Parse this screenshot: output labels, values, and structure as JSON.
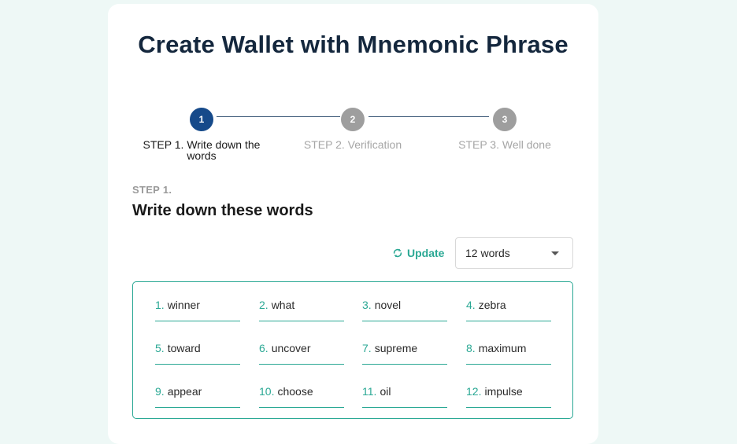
{
  "page": {
    "title": "Create Wallet with Mnemonic Phrase"
  },
  "stepper": {
    "steps": [
      {
        "number": "1",
        "label": "STEP 1. Write down the words",
        "state": "active"
      },
      {
        "number": "2",
        "label": "STEP 2. Verification",
        "state": "inactive"
      },
      {
        "number": "3",
        "label": "STEP 3. Well done",
        "state": "inactive"
      }
    ]
  },
  "section": {
    "kicker": "STEP 1.",
    "title": "Write down these words"
  },
  "controls": {
    "update_label": "Update",
    "update_icon": "refresh-icon",
    "word_count_selected": "12 words",
    "dropdown_icon": "caret-down-icon"
  },
  "mnemonic": {
    "words": [
      {
        "num": "1.",
        "word": "winner"
      },
      {
        "num": "2.",
        "word": "what"
      },
      {
        "num": "3.",
        "word": "novel"
      },
      {
        "num": "4.",
        "word": "zebra"
      },
      {
        "num": "5.",
        "word": "toward"
      },
      {
        "num": "6.",
        "word": "uncover"
      },
      {
        "num": "7.",
        "word": "supreme"
      },
      {
        "num": "8.",
        "word": "maximum"
      },
      {
        "num": "9.",
        "word": "appear"
      },
      {
        "num": "10.",
        "word": "choose"
      },
      {
        "num": "11.",
        "word": "oil"
      },
      {
        "num": "12.",
        "word": "impulse"
      }
    ]
  },
  "colors": {
    "accent": "#2aa894",
    "step_active": "#164a8a",
    "step_inactive": "#9e9e9e",
    "title": "#14273d",
    "background": "#eef8f6"
  }
}
